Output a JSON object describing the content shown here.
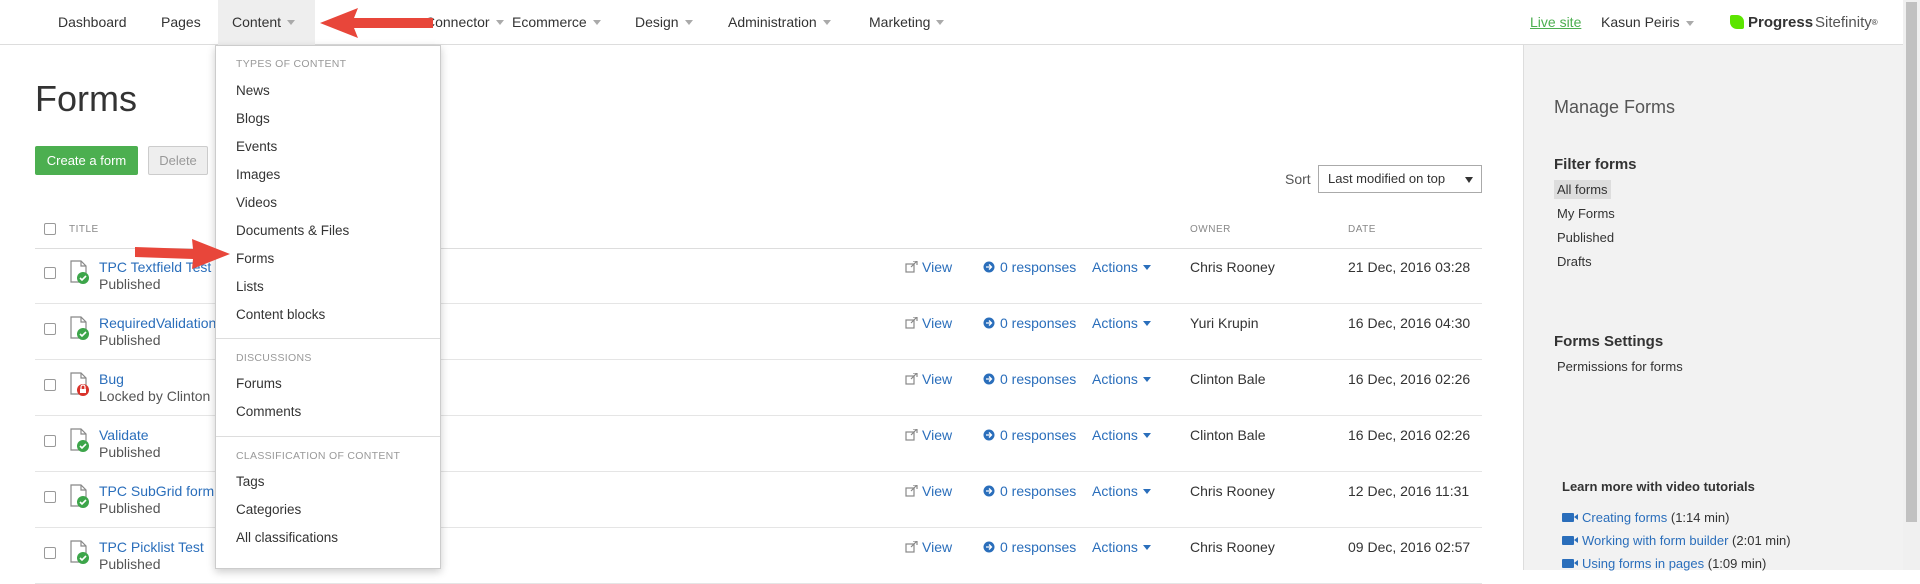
{
  "nav": {
    "items": [
      "Dashboard",
      "Pages",
      "Content",
      "Connector",
      "Ecommerce",
      "Design",
      "Administration",
      "Marketing"
    ],
    "live_site": "Live site",
    "user": "Kasun Peiris",
    "logo_brand": "Progress",
    "logo_product": "Sitefinity",
    "logo_tm": "®"
  },
  "content_menu": {
    "section1": "TYPES OF CONTENT",
    "items1": [
      "News",
      "Blogs",
      "Events",
      "Images",
      "Videos",
      "Documents & Files",
      "Forms",
      "Lists",
      "Content blocks"
    ],
    "section2": "DISCUSSIONS",
    "items2": [
      "Forums",
      "Comments"
    ],
    "section3": "CLASSIFICATION OF CONTENT",
    "items3": [
      "Tags",
      "Categories",
      "All classifications"
    ]
  },
  "main": {
    "title": "Forms",
    "create_button": "Create a form",
    "delete_button": "Delete",
    "sort_label": "Sort",
    "sort_value": "Last modified on top",
    "columns": {
      "title": "TITLE",
      "owner": "OWNER",
      "date": "DATE"
    },
    "view_label": "View",
    "actions_label": "Actions",
    "rows": [
      {
        "title": "TPC Textfield Test",
        "status": "Published",
        "responses": "0 responses",
        "owner": "Chris Rooney",
        "date": "21 Dec, 2016 03:28",
        "locked": false
      },
      {
        "title": "RequiredValidation",
        "status": "Published",
        "responses": "0 responses",
        "owner": "Yuri Krupin",
        "date": "16 Dec, 2016 04:30",
        "locked": false
      },
      {
        "title": "Bug",
        "status": "Locked by Clinton B",
        "responses": "0 responses",
        "owner": "Clinton Bale",
        "date": "16 Dec, 2016 02:26",
        "locked": true
      },
      {
        "title": "Validate",
        "status": "Published",
        "responses": "0 responses",
        "owner": "Clinton Bale",
        "date": "16 Dec, 2016 02:26",
        "locked": false
      },
      {
        "title": "TPC SubGrid form T",
        "status": "Published",
        "responses": "0 responses",
        "owner": "Chris Rooney",
        "date": "12 Dec, 2016 11:31",
        "locked": false
      },
      {
        "title": "TPC Picklist Test",
        "status": "Published",
        "responses": "0 responses",
        "owner": "Chris Rooney",
        "date": "09 Dec, 2016 02:57",
        "locked": false
      }
    ]
  },
  "sidebar": {
    "title": "Manage Forms",
    "filter_heading": "Filter forms",
    "filters": [
      "All forms",
      "My Forms",
      "Published",
      "Drafts"
    ],
    "settings_heading": "Forms Settings",
    "settings_link": "Permissions for forms",
    "tutorials_heading": "Learn more with video tutorials",
    "tutorials": [
      {
        "label": "Creating forms",
        "duration": "(1:14 min)"
      },
      {
        "label": "Working with form builder",
        "duration": "(2:01 min)"
      },
      {
        "label": "Using forms in pages",
        "duration": "(1:09 min)"
      }
    ]
  },
  "colors": {
    "accent_green": "#4caf50",
    "link_blue": "#2a6ebb",
    "arrow_red": "#e8463a"
  }
}
